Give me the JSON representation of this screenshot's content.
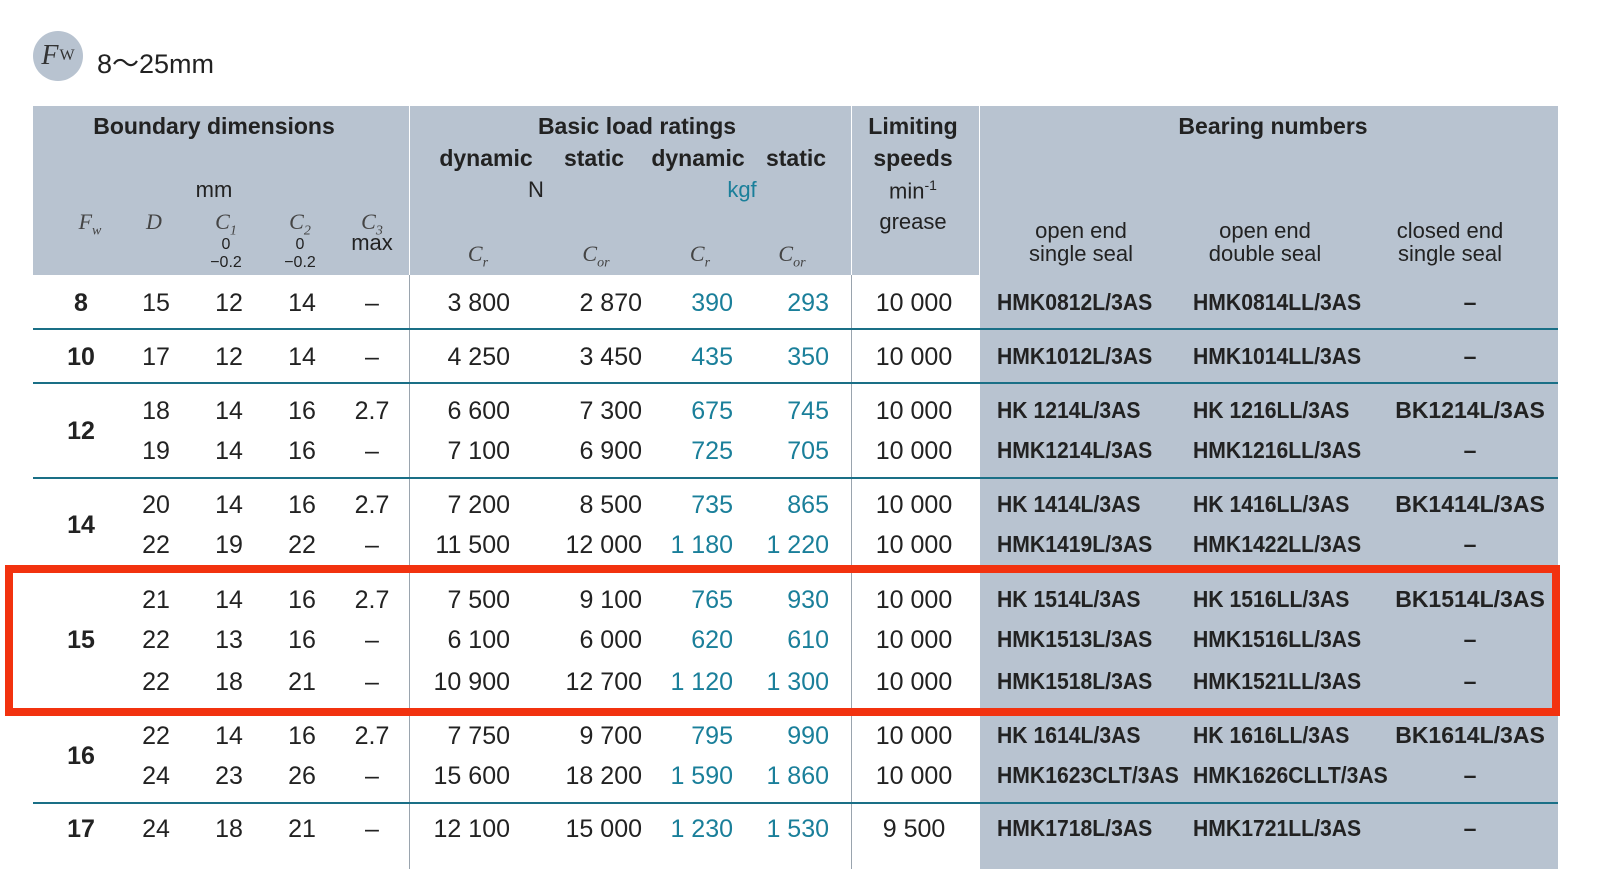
{
  "badge": {
    "symbol": "F",
    "subscript": "W"
  },
  "range_title": "8～25mm",
  "header": {
    "boundary": "Boundary dimensions",
    "unit_mm": "mm",
    "load": "Basic load ratings",
    "dynamic1": "dynamic",
    "static1": "static",
    "dynamic2": "dynamic",
    "static2": "static",
    "unit_n": "N",
    "unit_kgf": "kgf",
    "limiting1": "Limiting",
    "limiting2": "speeds",
    "limiting_unit": "min-1",
    "grease": "grease",
    "bearing_numbers": "Bearing numbers",
    "col_fw": "Fw",
    "col_d": "D",
    "col_c1": "C1",
    "col_c2": "C2",
    "col_c3": "C3",
    "col_c3_max": "max",
    "tol_top": "0",
    "tol_bottom": "−0.2",
    "col_cr": "Cr",
    "col_cor": "Cor",
    "open_single1": "open end",
    "open_single2": "single seal",
    "open_double1": "open end",
    "open_double2": "double seal",
    "closed_single1": "closed end",
    "closed_single2": "single seal"
  },
  "groups": [
    {
      "fw": "8",
      "rows": [
        {
          "D": "15",
          "C1": "12",
          "C2": "14",
          "C3": "–",
          "Cr_N": "3 800",
          "Cor_N": "2 870",
          "Cr_kgf": "390",
          "Cor_kgf": "293",
          "speed": "10 000",
          "open_single": "HMK0812L/3AS",
          "open_double": "HMK0814LL/3AS",
          "closed_single": "–"
        }
      ]
    },
    {
      "fw": "10",
      "rows": [
        {
          "D": "17",
          "C1": "12",
          "C2": "14",
          "C3": "–",
          "Cr_N": "4 250",
          "Cor_N": "3 450",
          "Cr_kgf": "435",
          "Cor_kgf": "350",
          "speed": "10 000",
          "open_single": "HMK1012L/3AS",
          "open_double": "HMK1014LL/3AS",
          "closed_single": "–"
        }
      ]
    },
    {
      "fw": "12",
      "rows": [
        {
          "D": "18",
          "C1": "14",
          "C2": "16",
          "C3": "2.7",
          "Cr_N": "6 600",
          "Cor_N": "7 300",
          "Cr_kgf": "675",
          "Cor_kgf": "745",
          "speed": "10 000",
          "open_single": "HK  1214L/3AS",
          "open_double": "HK  1216LL/3AS",
          "closed_single": "BK1214L/3AS"
        },
        {
          "D": "19",
          "C1": "14",
          "C2": "16",
          "C3": "–",
          "Cr_N": "7 100",
          "Cor_N": "6 900",
          "Cr_kgf": "725",
          "Cor_kgf": "705",
          "speed": "10 000",
          "open_single": "HMK1214L/3AS",
          "open_double": "HMK1216LL/3AS",
          "closed_single": "–"
        }
      ]
    },
    {
      "fw": "14",
      "rows": [
        {
          "D": "20",
          "C1": "14",
          "C2": "16",
          "C3": "2.7",
          "Cr_N": "7 200",
          "Cor_N": "8 500",
          "Cr_kgf": "735",
          "Cor_kgf": "865",
          "speed": "10 000",
          "open_single": "HK  1414L/3AS",
          "open_double": "HK  1416LL/3AS",
          "closed_single": "BK1414L/3AS"
        },
        {
          "D": "22",
          "C1": "19",
          "C2": "22",
          "C3": "–",
          "Cr_N": "11 500",
          "Cor_N": "12 000",
          "Cr_kgf": "1 180",
          "Cor_kgf": "1 220",
          "speed": "10 000",
          "open_single": "HMK1419L/3AS",
          "open_double": "HMK1422LL/3AS",
          "closed_single": "–"
        }
      ]
    },
    {
      "fw": "15",
      "rows": [
        {
          "D": "21",
          "C1": "14",
          "C2": "16",
          "C3": "2.7",
          "Cr_N": "7 500",
          "Cor_N": "9 100",
          "Cr_kgf": "765",
          "Cor_kgf": "930",
          "speed": "10 000",
          "open_single": "HK  1514L/3AS",
          "open_double": "HK  1516LL/3AS",
          "closed_single": "BK1514L/3AS"
        },
        {
          "D": "22",
          "C1": "13",
          "C2": "16",
          "C3": "–",
          "Cr_N": "6 100",
          "Cor_N": "6 000",
          "Cr_kgf": "620",
          "Cor_kgf": "610",
          "speed": "10 000",
          "open_single": "HMK1513L/3AS",
          "open_double": "HMK1516LL/3AS",
          "closed_single": "–"
        },
        {
          "D": "22",
          "C1": "18",
          "C2": "21",
          "C3": "–",
          "Cr_N": "10 900",
          "Cor_N": "12 700",
          "Cr_kgf": "1 120",
          "Cor_kgf": "1 300",
          "speed": "10 000",
          "open_single": "HMK1518L/3AS",
          "open_double": "HMK1521LL/3AS",
          "closed_single": "–"
        }
      ]
    },
    {
      "fw": "16",
      "rows": [
        {
          "D": "22",
          "C1": "14",
          "C2": "16",
          "C3": "2.7",
          "Cr_N": "7 750",
          "Cor_N": "9 700",
          "Cr_kgf": "795",
          "Cor_kgf": "990",
          "speed": "10 000",
          "open_single": "HK  1614L/3AS",
          "open_double": "HK  1616LL/3AS",
          "closed_single": "BK1614L/3AS"
        },
        {
          "D": "24",
          "C1": "23",
          "C2": "26",
          "C3": "–",
          "Cr_N": "15 600",
          "Cor_N": "18 200",
          "Cr_kgf": "1 590",
          "Cor_kgf": "1 860",
          "speed": "10 000",
          "open_single": "HMK1623CLT/3AS",
          "open_double": "HMK1626CLLT/3AS",
          "closed_single": "–"
        }
      ]
    },
    {
      "fw": "17",
      "rows": [
        {
          "D": "24",
          "C1": "18",
          "C2": "21",
          "C3": "–",
          "Cr_N": "12 100",
          "Cor_N": "15 000",
          "Cr_kgf": "1 230",
          "Cor_kgf": "1 530",
          "speed": "9 500",
          "open_single": "HMK1718L/3AS",
          "open_double": "HMK1721LL/3AS",
          "closed_single": "–"
        }
      ]
    }
  ],
  "colors": {
    "header_bg": "#b8c3d0",
    "teal": "#1a7f9a",
    "rule": "#1a6f86",
    "highlight": "#f2320f"
  }
}
